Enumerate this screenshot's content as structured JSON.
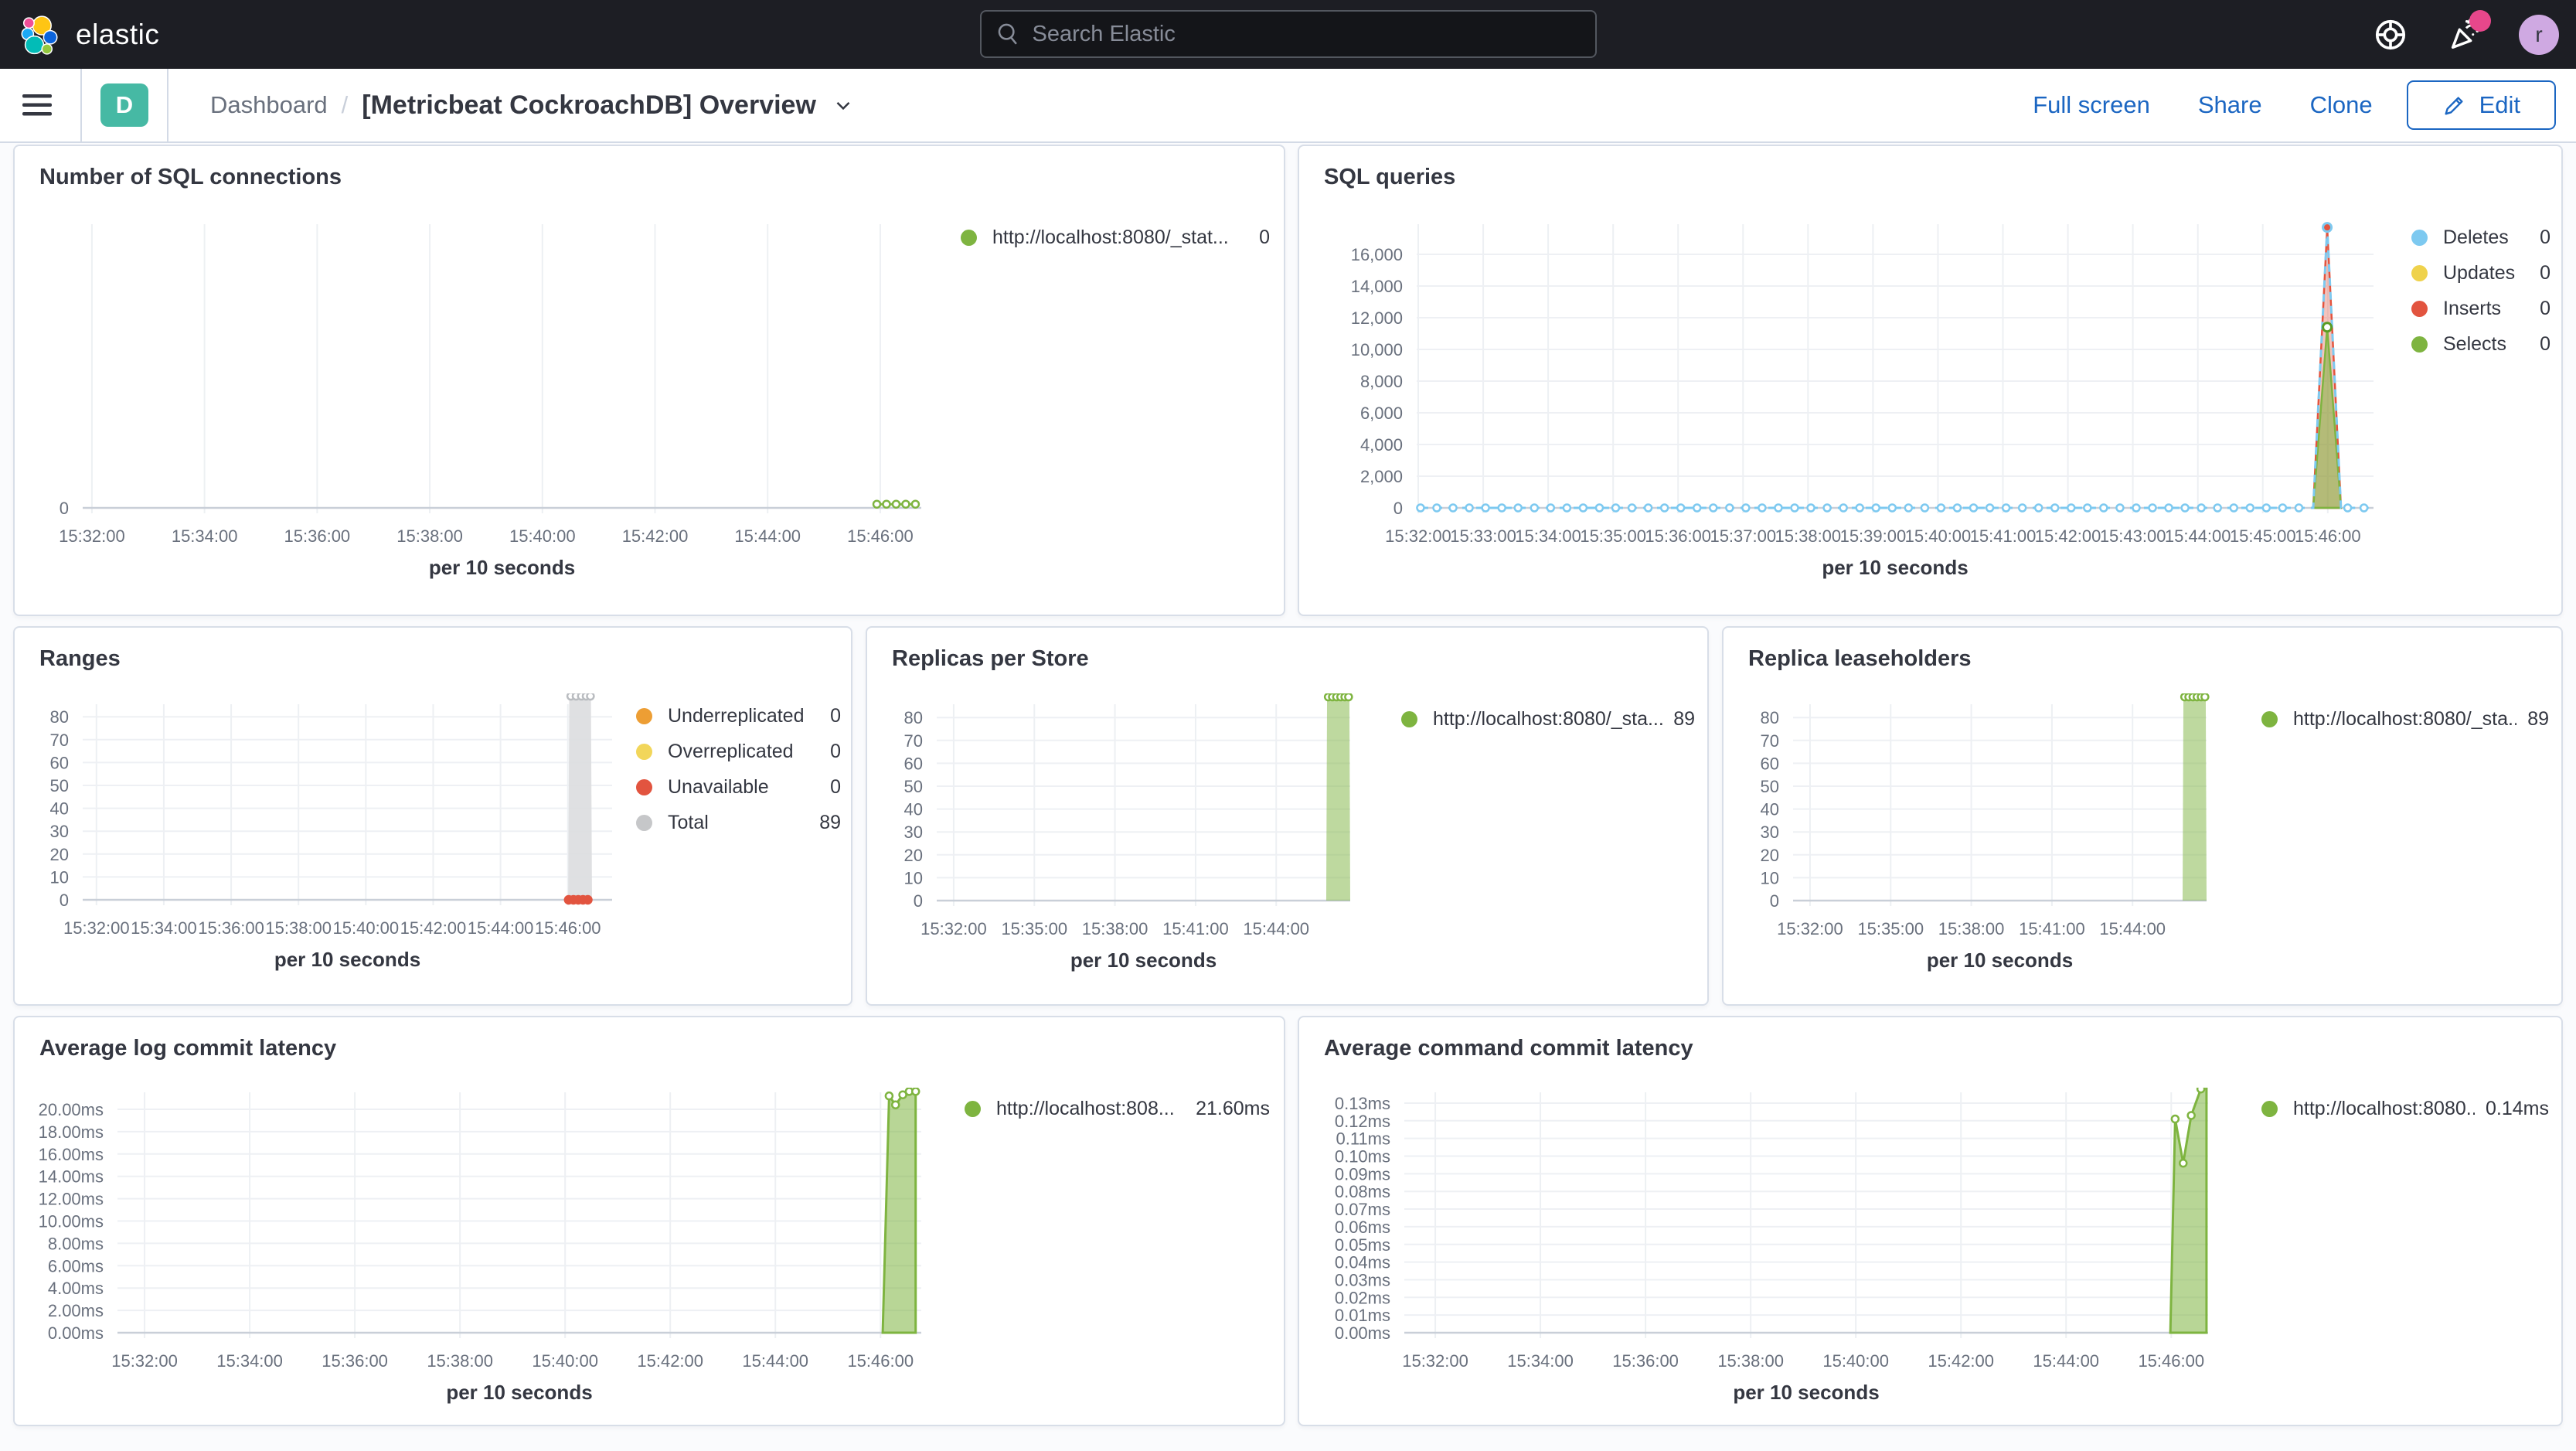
{
  "header": {
    "brand": "elastic",
    "search": {
      "placeholder": "Search Elastic"
    },
    "avatar_initial": "r"
  },
  "toolbar": {
    "badge": "D",
    "breadcrumb_root": "Dashboard",
    "breadcrumb_separator": "/",
    "title": "[Metricbeat CockroachDB] Overview",
    "actions": [
      "Full screen",
      "Share",
      "Clone"
    ],
    "edit_label": "Edit"
  },
  "colors": {
    "accent_blue": "#1b66c2",
    "badge_teal": "#46b9a4",
    "series_green": "#7eb440",
    "series_blue": "#7dc9f0",
    "series_yellow": "#efd24c",
    "series_red": "#e2543f",
    "series_orange": "#ed9e34",
    "series_gray": "#c6c7c9"
  },
  "chart_data": {
    "sql_connections": {
      "type": "line",
      "title": "Number of SQL connections",
      "x_axis_title": "per 10 seconds",
      "x_ticks": [
        "15:32:00",
        "15:34:00",
        "15:36:00",
        "15:38:00",
        "15:40:00",
        "15:42:00",
        "15:44:00",
        "15:46:00"
      ],
      "y_ticks": [
        {
          "v": 0,
          "l": "0"
        }
      ],
      "ylim": [
        0,
        1
      ],
      "series": [
        {
          "name": "http://localhost:8080/_stat...",
          "type": "line",
          "color": "#7eb440",
          "width": 3,
          "points": [
            [
              0.947,
              0.03
            ],
            [
              0.996,
              0.03
            ]
          ],
          "marker_every": 0.0115,
          "marker_max": 1000,
          "marker_r": 4.5
        }
      ],
      "legend": [
        {
          "label": "http://localhost:8080/_stat...",
          "value": "0",
          "color": "#7eb440"
        }
      ]
    },
    "sql_queries": {
      "type": "area",
      "title": "SQL queries",
      "x_axis_title": "per 10 seconds",
      "x_ticks": [
        "15:32:00",
        "15:33:00",
        "15:34:00",
        "15:35:00",
        "15:36:00",
        "15:37:00",
        "15:38:00",
        "15:39:00",
        "15:40:00",
        "15:41:00",
        "15:42:00",
        "15:43:00",
        "15:44:00",
        "15:45:00",
        "15:46:00"
      ],
      "y_ticks": [
        {
          "v": 0,
          "l": "0"
        },
        {
          "v": 2000,
          "l": "2,000"
        },
        {
          "v": 4000,
          "l": "4,000"
        },
        {
          "v": 6000,
          "l": "6,000"
        },
        {
          "v": 8000,
          "l": "8,000"
        },
        {
          "v": 10000,
          "l": "10,000"
        },
        {
          "v": 12000,
          "l": "12,000"
        },
        {
          "v": 14000,
          "l": "14,000"
        },
        {
          "v": 16000,
          "l": "16,000"
        }
      ],
      "ylim": [
        0,
        17800
      ],
      "series": [
        {
          "name": "Inserts",
          "type": "area",
          "color": "#e2543f",
          "fill_opacity": 0.35,
          "width": 2.5,
          "points": [
            [
              0.937,
              0
            ],
            [
              0.9516,
              17700
            ],
            [
              0.966,
              0
            ]
          ]
        },
        {
          "name": "Selects",
          "type": "area",
          "color": "#7eb440",
          "fill_opacity": 0.55,
          "width": 2.5,
          "points": [
            [
              0.937,
              0
            ],
            [
              0.9516,
              11400
            ],
            [
              0.966,
              0
            ]
          ]
        },
        {
          "name": "Deletes",
          "type": "line",
          "color": "#7dc9f0",
          "width": 3,
          "dashed": true,
          "points": [
            [
              0.004,
              0
            ],
            [
              0.937,
              0
            ],
            [
              0.9516,
              17700
            ],
            [
              0.966,
              0
            ],
            [
              0.995,
              0
            ]
          ],
          "marker_every": 0.017,
          "marker_max": 300,
          "marker_r": 4.5
        }
      ],
      "peak_markers": [
        {
          "f": 0.9516,
          "v": 17700,
          "color": "#7dc9f0",
          "fill": "#e2543f"
        },
        {
          "f": 0.9516,
          "v": 11400,
          "color": "#5b9c23",
          "fill": "#ffffff"
        }
      ],
      "legend": [
        {
          "label": "Deletes",
          "value": "0",
          "color": "#7dc9f0"
        },
        {
          "label": "Updates",
          "value": "0",
          "color": "#efd24c"
        },
        {
          "label": "Inserts",
          "value": "0",
          "color": "#e2543f"
        },
        {
          "label": "Selects",
          "value": "0",
          "color": "#7eb440"
        }
      ]
    },
    "ranges": {
      "type": "bar",
      "title": "Ranges",
      "x_axis_title": "per 10 seconds",
      "x_ticks": [
        "15:32:00",
        "15:34:00",
        "15:36:00",
        "15:38:00",
        "15:40:00",
        "15:42:00",
        "15:44:00",
        "15:46:00"
      ],
      "y_ticks": [
        {
          "v": 0,
          "l": "0"
        },
        {
          "v": 10,
          "l": "10"
        },
        {
          "v": 20,
          "l": "20"
        },
        {
          "v": 30,
          "l": "30"
        },
        {
          "v": 40,
          "l": "40"
        },
        {
          "v": 50,
          "l": "50"
        },
        {
          "v": 60,
          "l": "60"
        },
        {
          "v": 70,
          "l": "70"
        },
        {
          "v": 80,
          "l": "80"
        }
      ],
      "ylim": [
        0,
        90
      ],
      "series": [
        {
          "name": "Total",
          "type": "area",
          "color": "#dcdddf",
          "fill_opacity": 0.9,
          "width": 0,
          "points": [
            [
              0.917,
              0
            ],
            [
              0.919,
              89
            ],
            [
              0.96,
              89
            ],
            [
              0.962,
              0
            ]
          ],
          "markers": [
            [
              0.922,
              89
            ],
            [
              0.932,
              89
            ],
            [
              0.942,
              89
            ],
            [
              0.951,
              89
            ],
            [
              0.959,
              89
            ]
          ],
          "marker_color": "#b9bcc0",
          "marker_r": 4.5
        },
        {
          "name": "Unavailable",
          "type": "line",
          "color": "#e2543f",
          "width": 3,
          "points": [
            [
              0.918,
              0
            ],
            [
              0.961,
              0
            ]
          ],
          "marker_every": 0.009,
          "marker_max": 5,
          "marker_fill": "solid",
          "marker_r": 5
        }
      ],
      "legend": [
        {
          "label": "Underreplicated",
          "value": "0",
          "color": "#ed9e34"
        },
        {
          "label": "Overreplicated",
          "value": "0",
          "color": "#f2d65a"
        },
        {
          "label": "Unavailable",
          "value": "0",
          "color": "#e2543f"
        },
        {
          "label": "Total",
          "value": "89",
          "color": "#c6c7c9"
        }
      ]
    },
    "replicas_per_store": {
      "type": "bar",
      "title": "Replicas per Store",
      "x_axis_title": "per 10 seconds",
      "x_ticks": [
        "15:32:00",
        "15:35:00",
        "15:38:00",
        "15:41:00",
        "15:44:00"
      ],
      "y_ticks": [
        {
          "v": 0,
          "l": "0"
        },
        {
          "v": 10,
          "l": "10"
        },
        {
          "v": 20,
          "l": "20"
        },
        {
          "v": 30,
          "l": "30"
        },
        {
          "v": 40,
          "l": "40"
        },
        {
          "v": 50,
          "l": "50"
        },
        {
          "v": 60,
          "l": "60"
        },
        {
          "v": 70,
          "l": "70"
        },
        {
          "v": 80,
          "l": "80"
        }
      ],
      "ylim": [
        0,
        90
      ],
      "series": [
        {
          "name": "http://localhost:8080/_sta...",
          "type": "area",
          "color": "#7eb440",
          "fill_opacity": 0.5,
          "width": 0,
          "points": [
            [
              0.942,
              0
            ],
            [
              0.944,
              89
            ],
            [
              0.998,
              89
            ],
            [
              1.0,
              0
            ]
          ],
          "markers": [
            [
              0.947,
              89
            ],
            [
              0.957,
              89
            ],
            [
              0.967,
              89
            ],
            [
              0.977,
              89
            ],
            [
              0.987,
              89
            ],
            [
              0.996,
              89
            ]
          ],
          "marker_color": "#7eb440",
          "marker_r": 4.5
        }
      ],
      "legend": [
        {
          "label": "http://localhost:8080/_sta...",
          "value": "89",
          "color": "#7eb440"
        }
      ]
    },
    "replica_leaseholders": {
      "type": "bar",
      "title": "Replica leaseholders",
      "x_axis_title": "per 10 seconds",
      "x_ticks": [
        "15:32:00",
        "15:35:00",
        "15:38:00",
        "15:41:00",
        "15:44:00"
      ],
      "y_ticks": [
        {
          "v": 0,
          "l": "0"
        },
        {
          "v": 10,
          "l": "10"
        },
        {
          "v": 20,
          "l": "20"
        },
        {
          "v": 30,
          "l": "30"
        },
        {
          "v": 40,
          "l": "40"
        },
        {
          "v": 50,
          "l": "50"
        },
        {
          "v": 60,
          "l": "60"
        },
        {
          "v": 70,
          "l": "70"
        },
        {
          "v": 80,
          "l": "80"
        }
      ],
      "ylim": [
        0,
        90
      ],
      "series": [
        {
          "name": "http://localhost:8080/_sta...",
          "type": "area",
          "color": "#7eb440",
          "fill_opacity": 0.5,
          "width": 0,
          "points": [
            [
              0.942,
              0
            ],
            [
              0.944,
              89
            ],
            [
              0.998,
              89
            ],
            [
              1.0,
              0
            ]
          ],
          "markers": [
            [
              0.947,
              89
            ],
            [
              0.957,
              89
            ],
            [
              0.967,
              89
            ],
            [
              0.977,
              89
            ],
            [
              0.987,
              89
            ],
            [
              0.996,
              89
            ]
          ],
          "marker_color": "#7eb440",
          "marker_r": 4.5
        }
      ],
      "legend": [
        {
          "label": "http://localhost:8080/_sta...",
          "value": "89",
          "color": "#7eb440"
        }
      ]
    },
    "avg_log_commit_latency": {
      "type": "area",
      "title": "Average log commit latency",
      "x_axis_title": "per 10 seconds",
      "x_ticks": [
        "15:32:00",
        "15:34:00",
        "15:36:00",
        "15:38:00",
        "15:40:00",
        "15:42:00",
        "15:44:00",
        "15:46:00"
      ],
      "y_ticks": [
        {
          "v": 0,
          "l": "0.00ms"
        },
        {
          "v": 2,
          "l": "2.00ms"
        },
        {
          "v": 4,
          "l": "4.00ms"
        },
        {
          "v": 6,
          "l": "6.00ms"
        },
        {
          "v": 8,
          "l": "8.00ms"
        },
        {
          "v": 10,
          "l": "10.00ms"
        },
        {
          "v": 12,
          "l": "12.00ms"
        },
        {
          "v": 14,
          "l": "14.00ms"
        },
        {
          "v": 16,
          "l": "16.00ms"
        },
        {
          "v": 18,
          "l": "18.00ms"
        },
        {
          "v": 20,
          "l": "20.00ms"
        }
      ],
      "ylim": [
        0,
        21.8
      ],
      "series": [
        {
          "name": "http://localhost:808...",
          "type": "area",
          "color": "#7eb440",
          "fill_opacity": 0.55,
          "width": 3,
          "points": [
            [
              0.952,
              0
            ],
            [
              0.96,
              21.2
            ],
            [
              0.968,
              20.4
            ],
            [
              0.977,
              21.3
            ],
            [
              0.985,
              21.6
            ],
            [
              0.993,
              21.6
            ]
          ],
          "markers": [
            [
              0.96,
              21.2
            ],
            [
              0.968,
              20.4
            ],
            [
              0.977,
              21.3
            ],
            [
              0.985,
              21.6
            ],
            [
              0.993,
              21.6
            ]
          ],
          "marker_color": "#7eb440",
          "marker_r": 4.5
        }
      ],
      "legend": [
        {
          "label": "http://localhost:808...",
          "value": "21.60ms",
          "color": "#7eb440"
        }
      ]
    },
    "avg_command_commit_latency": {
      "type": "area",
      "title": "Average command commit latency",
      "x_axis_title": "per 10 seconds",
      "x_ticks": [
        "15:32:00",
        "15:34:00",
        "15:36:00",
        "15:38:00",
        "15:40:00",
        "15:42:00",
        "15:44:00",
        "15:46:00"
      ],
      "y_ticks": [
        {
          "v": 0,
          "l": "0.00ms"
        },
        {
          "v": 0.01,
          "l": "0.01ms"
        },
        {
          "v": 0.02,
          "l": "0.02ms"
        },
        {
          "v": 0.03,
          "l": "0.03ms"
        },
        {
          "v": 0.04,
          "l": "0.04ms"
        },
        {
          "v": 0.05,
          "l": "0.05ms"
        },
        {
          "v": 0.06,
          "l": "0.06ms"
        },
        {
          "v": 0.07,
          "l": "0.07ms"
        },
        {
          "v": 0.08,
          "l": "0.08ms"
        },
        {
          "v": 0.09,
          "l": "0.09ms"
        },
        {
          "v": 0.1,
          "l": "0.10ms"
        },
        {
          "v": 0.11,
          "l": "0.11ms"
        },
        {
          "v": 0.12,
          "l": "0.12ms"
        },
        {
          "v": 0.13,
          "l": "0.13ms"
        }
      ],
      "ylim": [
        0,
        0.14
      ],
      "series": [
        {
          "name": "http://localhost:8080...",
          "type": "area",
          "color": "#7eb440",
          "fill_opacity": 0.55,
          "width": 3,
          "points": [
            [
              0.953,
              0
            ],
            [
              0.959,
              0.121
            ],
            [
              0.969,
              0.096
            ],
            [
              0.979,
              0.123
            ],
            [
              0.991,
              0.138
            ],
            [
              0.998,
              0.14
            ]
          ],
          "markers": [
            [
              0.959,
              0.121
            ],
            [
              0.969,
              0.096
            ],
            [
              0.979,
              0.123
            ],
            [
              0.991,
              0.138
            ]
          ],
          "marker_color": "#7eb440",
          "marker_r": 4.5
        }
      ],
      "legend": [
        {
          "label": "http://localhost:8080...",
          "value": "0.14ms",
          "color": "#7eb440"
        }
      ]
    }
  }
}
